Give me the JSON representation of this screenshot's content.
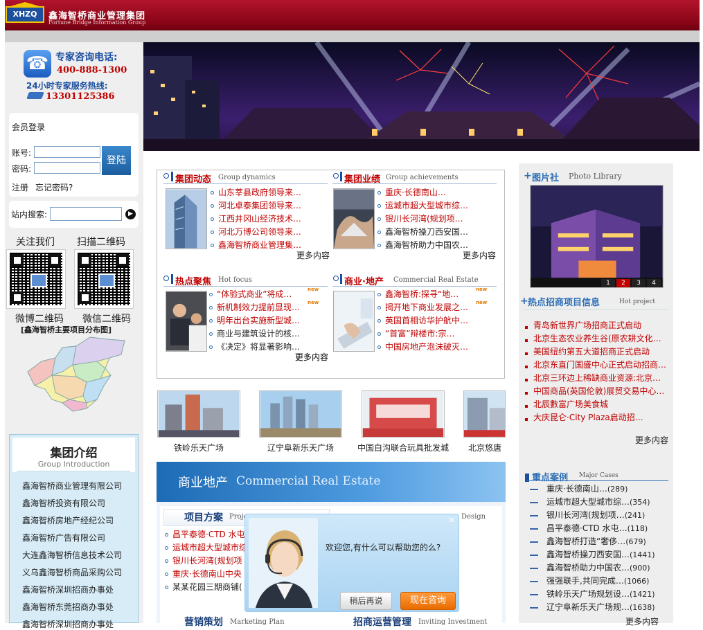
{
  "header": {
    "logo_text": "XHZQ",
    "brand_cn": "鑫海智桥商业管理集团",
    "brand_en": "Fortune Bridge Information Group"
  },
  "hotline": {
    "title": "专家咨询电话:",
    "number": "400-888-1300",
    "service": "24小时专家服务热线:",
    "mobile": "13301125386"
  },
  "login": {
    "title": "会员登录",
    "account_label": "账号:",
    "password_label": "密码:",
    "submit": "登陆",
    "register": "注册",
    "forgot": "忘记密码?"
  },
  "search": {
    "label": "站内搜索:"
  },
  "qr": {
    "follow": "关注我们",
    "scan": "扫描二维码",
    "weibo": "微博二维码",
    "wechat": "微信二维码"
  },
  "map": {
    "title": "[鑫海智桥主要项目分布图]"
  },
  "intro": {
    "title_cn": "集团介绍",
    "title_en": "Group Introduction",
    "items": [
      "鑫海智桥商业管理有限公司",
      "鑫海智桥投资有限公司",
      "鑫海智桥房地产经纪公司",
      "鑫海智桥广告有限公司",
      "大连鑫海智桥信息技术公司",
      "义乌鑫海智桥商品采购公司",
      "鑫海智桥深圳招商办事处",
      "鑫海智桥东莞招商办事处",
      "鑫海智桥深圳招商办事处"
    ]
  },
  "sections": {
    "dynamics": {
      "title": "集团动态",
      "en": "Group dynamics",
      "items": [
        "山东莘县政府领导来…",
        "河北卓泰集团领导来…",
        "江西井冈山经济技术…",
        "河北万博公司领导来…",
        "鑫海智桥商业管理集…"
      ],
      "more": "更多内容"
    },
    "achievements": {
      "title": "集团业绩",
      "en": "Group achievements",
      "items": [
        "重庆·长德南山…",
        "运城市超大型城市综…",
        "银川长河湾(规划项…",
        "鑫海智桥操刀西安国…",
        "鑫海智桥助力中国农…"
      ],
      "more": "更多内容"
    },
    "focus": {
      "title": "热点聚焦",
      "en": "Hot focus",
      "items": [
        "“体验式商业”将成…",
        "新机制效力提前显现…",
        "明年出台实施新型城…",
        "商业与建筑设计的核…",
        "《决定》将显著影响…"
      ],
      "more": "更多内容",
      "new": "new"
    },
    "realestate": {
      "title": "商业·地产",
      "en": "Commercial Real Estate",
      "items": [
        "鑫海智桥:探寻“地…",
        "揭开地下商业发展之…",
        "英国首相访华护航中…",
        "“首富”辩楼市:宗…",
        "中国房地产泡沫破灭…"
      ],
      "more": "更多内容",
      "new": "new"
    }
  },
  "strip": [
    "铁岭乐天广场",
    "辽宁阜新乐天广场",
    "中国白沟联合玩具批发城",
    "北京悠唐"
  ],
  "cre": {
    "title_cn": "商业地产",
    "title_en": "Commercial Real Estate",
    "plan_title": "项目方案",
    "plan_en": "Proje",
    "plan_items": [
      "昌平泰德·CTD 水屯",
      "运城市超大型城市综",
      "银川长河湾(规划项",
      "重庆·长德南山中央",
      "某某花园三期商铺("
    ],
    "design_en": "Design",
    "marketing": "营销策划",
    "marketing_en": "Marketing Plan",
    "investment": "招商运营管理",
    "investment_en": "Inviting Investment"
  },
  "right": {
    "photo_title": "图片社",
    "photo_en": "Photo Library",
    "pager": [
      "1",
      "2",
      "3",
      "4"
    ],
    "hot_title": "热点招商项目信息",
    "hot_en": "Hot project",
    "hot_items": [
      "青岛新世界广场招商正式启动",
      "北京生态农业养生谷(原农耕文化…",
      "美国纽约第五大道招商正式启动",
      "北京东直门国盛中心正式启动招商…",
      "北京三环边上稀缺商业资源:北京…",
      "中国商品(英国伦敦)展贸交易中心…",
      "北辰數富广场美食城",
      "大庆昆仑·City Plaza启动招…"
    ],
    "hot_more": "更多内容",
    "case_title": "重点案例",
    "case_en": "Major Cases",
    "cases": [
      {
        "name": "重庆·长德南山…",
        "count": "(289)"
      },
      {
        "name": "运城市超大型城市综…",
        "count": "(354)"
      },
      {
        "name": "银川长河湾(规划项…",
        "count": "(241)"
      },
      {
        "name": "昌平泰德·CTD 水屯…",
        "count": "(118)"
      },
      {
        "name": "鑫海智桥打造“奢侈…",
        "count": "(679)"
      },
      {
        "name": "鑫海智桥操刀西安国…",
        "count": "(1441)"
      },
      {
        "name": "鑫海智桥助力中国农…",
        "count": "(900)"
      },
      {
        "name": "强强联手,共同完成…",
        "count": "(1066)"
      },
      {
        "name": "铁岭乐天广场规划设…",
        "count": "(1421)"
      },
      {
        "name": "辽宁阜新乐天广场规…",
        "count": "(1638)"
      }
    ],
    "case_more": "更多内容"
  },
  "chat": {
    "message": "欢迎您,有什么可以帮助您的么?",
    "later": "稍后再说",
    "now": "现在咨询",
    "close": "×"
  }
}
